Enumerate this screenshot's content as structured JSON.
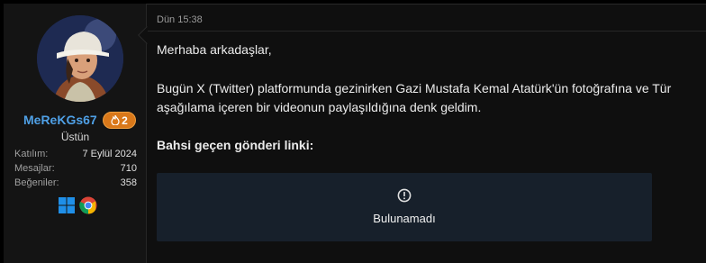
{
  "user": {
    "username": "MeReKGs67",
    "badge_count": "2",
    "title": "Üstün",
    "stats": [
      {
        "label": "Katılım:",
        "value": "7 Eylül 2024"
      },
      {
        "label": "Mesajlar:",
        "value": "710"
      },
      {
        "label": "Beğeniler:",
        "value": "358"
      }
    ],
    "icons": {
      "avatar": "avatar-image",
      "badge": "flame-icon",
      "os": "windows-icon",
      "browser": "chrome-icon"
    }
  },
  "post": {
    "timestamp": "Dün 15:38",
    "lines": [
      "Merhaba arkadaşlar,",
      "Bugün X (Twitter) platformunda gezinirken Gazi Mustafa Kemal Atatürk'ün fotoğrafına ve Tür",
      "aşağılama içeren bir videonun paylaşıldığına denk geldim.",
      "Bahsi geçen gönderi linki:"
    ],
    "embed": {
      "icon": "alert-circle-icon",
      "text": "Bulunamadı"
    }
  },
  "colors": {
    "accent": "#4fa0e6",
    "badge": "#d9781a",
    "embed_bg": "#17202b"
  }
}
